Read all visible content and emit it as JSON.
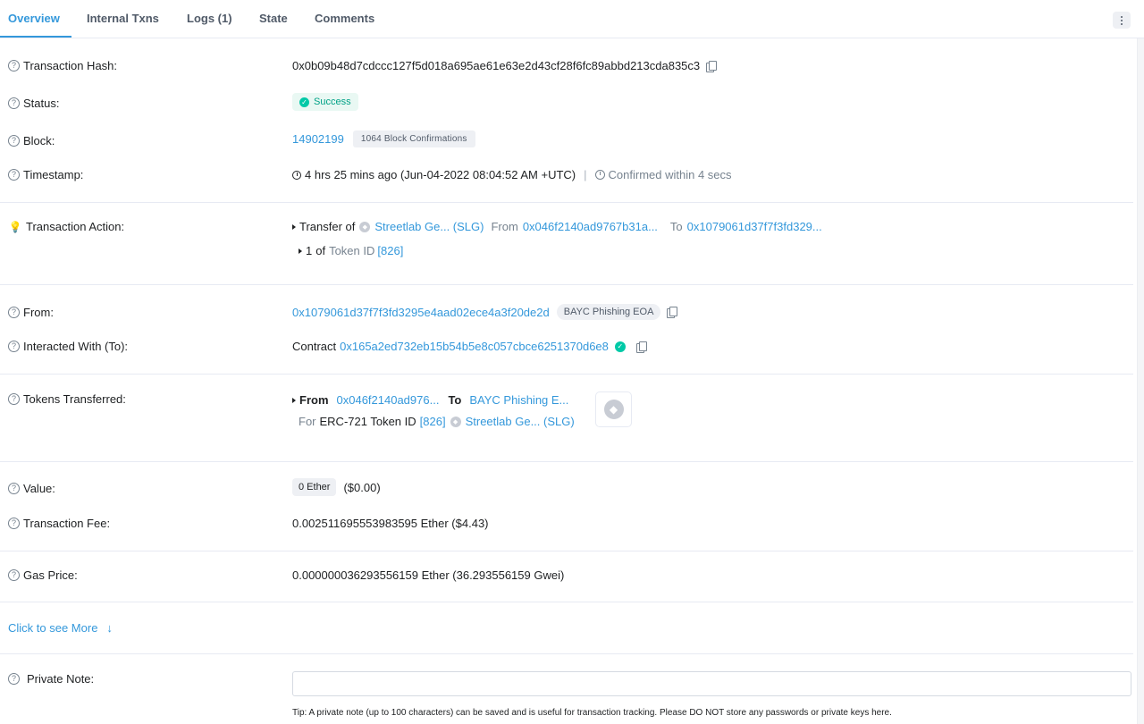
{
  "tabs": [
    {
      "label": "Overview",
      "active": true
    },
    {
      "label": "Internal Txns",
      "active": false
    },
    {
      "label": "Logs (1)",
      "active": false
    },
    {
      "label": "State",
      "active": false
    },
    {
      "label": "Comments",
      "active": false
    }
  ],
  "fields": {
    "tx_hash": {
      "label": "Transaction Hash:",
      "value": "0x0b09b48d7cdccc127f5d018a695ae61e63e2d43cf28f6fc89abbd213cda835c3"
    },
    "status": {
      "label": "Status:",
      "value": "Success"
    },
    "block": {
      "label": "Block:",
      "number": "14902199",
      "confirmations": "1064 Block Confirmations"
    },
    "timestamp": {
      "label": "Timestamp:",
      "value": "4 hrs 25 mins ago (Jun-04-2022 08:04:52 AM +UTC)",
      "confirmed": "Confirmed within 4 secs"
    },
    "action": {
      "label": "Transaction Action:",
      "transfer_of": "Transfer of",
      "token": "Streetlab Ge... (SLG)",
      "from_label": "From",
      "from": "0x046f2140ad9767b31a...",
      "to_label": "To",
      "to": "0x1079061d37f7f3fd329...",
      "qty": "1",
      "of_token_id": "of",
      "token_id_label": "Token ID",
      "token_id": "[826]"
    },
    "from": {
      "label": "From:",
      "address": "0x1079061d37f7f3fd3295e4aad02ece4a3f20de2d",
      "tag": "BAYC Phishing EOA"
    },
    "interacted": {
      "label": "Interacted With (To):",
      "prefix": "Contract",
      "address": "0x165a2ed732eb15b54b5e8c057cbce6251370d6e8"
    },
    "tokens": {
      "label": "Tokens Transferred:",
      "from_label": "From",
      "from": "0x046f2140ad976...",
      "to_label": "To",
      "to": "BAYC Phishing E...",
      "for_label": "For",
      "standard": "ERC-721 Token ID",
      "token_id": "[826]",
      "token": "Streetlab Ge... (SLG)"
    },
    "value": {
      "label": "Value:",
      "ether": "0 Ether",
      "usd": "($0.00)"
    },
    "fee": {
      "label": "Transaction Fee:",
      "value": "0.002511695553983595 Ether ($4.43)"
    },
    "gas": {
      "label": "Gas Price:",
      "value": "0.000000036293556159 Ether (36.293556159 Gwei)"
    }
  },
  "more": {
    "label": "Click to see More"
  },
  "note": {
    "label": "Private Note:",
    "value": "",
    "tip": "Tip: A private note (up to 100 characters) can be saved and is useful for transaction tracking. Please DO NOT store any passwords or private keys here."
  },
  "icons": {
    "help": "question-circle-icon",
    "copy": "copy-icon",
    "clock": "clock-icon",
    "bulb": "lightbulb-icon"
  },
  "colors": {
    "accent": "#3498db",
    "success": "#00c9a7",
    "text": "#1e2022",
    "muted": "#77838f"
  }
}
